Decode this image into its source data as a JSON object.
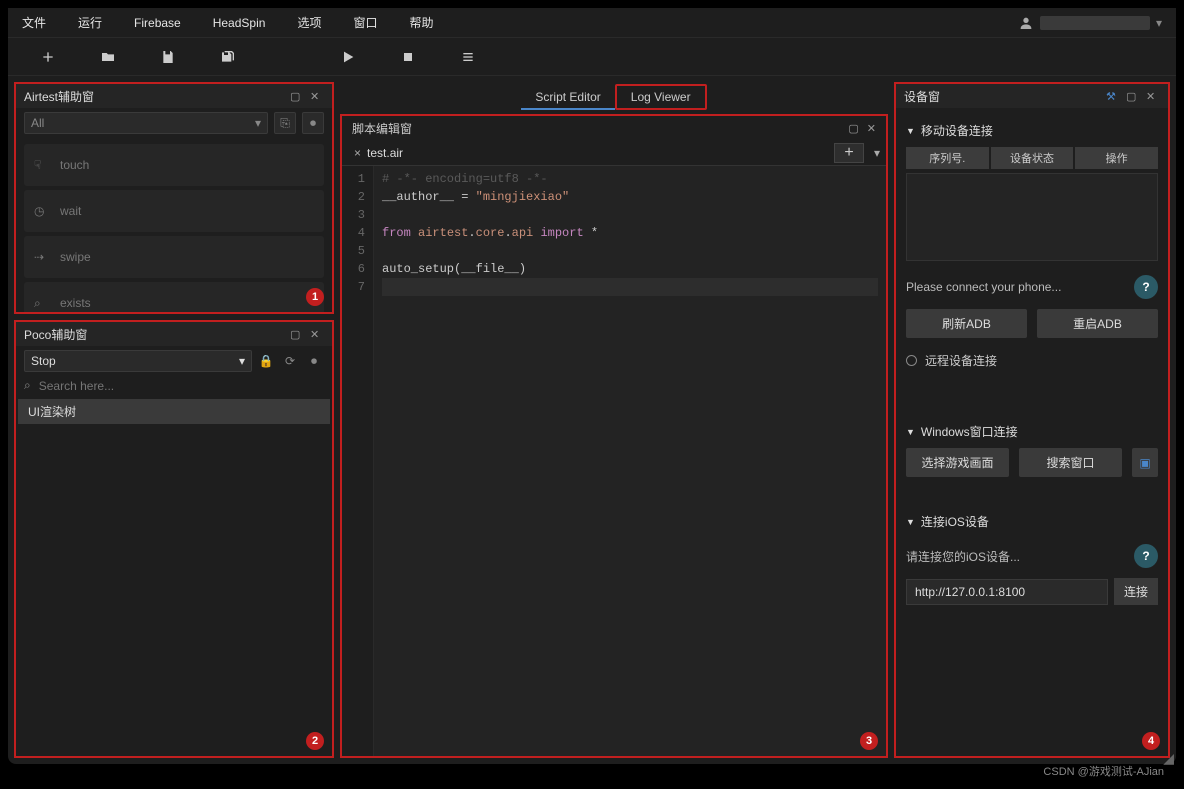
{
  "menu": {
    "items": [
      "文件",
      "运行",
      "Firebase",
      "HeadSpin",
      "选项",
      "窗口",
      "帮助"
    ]
  },
  "airtest": {
    "title": "Airtest辅助窗",
    "dropdown": "All",
    "items": [
      {
        "icon": "touch-icon",
        "label": "touch"
      },
      {
        "icon": "wait-icon",
        "label": "wait"
      },
      {
        "icon": "swipe-icon",
        "label": "swipe"
      },
      {
        "icon": "exists-icon",
        "label": "exists"
      }
    ],
    "badge": "1"
  },
  "poco": {
    "title": "Poco辅助窗",
    "dropdown": "Stop",
    "search_placeholder": "Search here...",
    "tree_item": "UI渲染树",
    "badge": "2"
  },
  "tabs": {
    "script_editor": "Script Editor",
    "log_viewer": "Log Viewer"
  },
  "editor": {
    "title": "脚本编辑窗",
    "file_tab": "test.air",
    "lines": [
      "1",
      "2",
      "3",
      "4",
      "5",
      "6",
      "7"
    ],
    "code": {
      "l1_comment": "# -*- encoding=utf8 -*-",
      "l2_var": "__author__",
      "l2_eq": " = ",
      "l2_str": "\"mingjiexiao\"",
      "l4_from": "from",
      "l4_mod1": " airtest",
      "l4_dot1": ".",
      "l4_mod2": "core",
      "l4_dot2": ".",
      "l4_mod3": "api",
      "l4_import": " import",
      "l4_star": " *",
      "l6": "auto_setup(__file__)"
    },
    "badge": "3"
  },
  "devices": {
    "title": "设备窗",
    "mobile_header": "移动设备连接",
    "table": {
      "col1": "序列号.",
      "col2": "设备状态",
      "col3": "操作"
    },
    "connect_msg": "Please connect your phone...",
    "refresh_adb": "刷新ADB",
    "restart_adb": "重启ADB",
    "remote_header": "远程设备连接",
    "windows_header": "Windows窗口连接",
    "select_game": "选择游戏画面",
    "search_window": "搜索窗口",
    "ios_header": "连接iOS设备",
    "ios_msg": "请连接您的iOS设备...",
    "ios_url": "http://127.0.0.1:8100",
    "connect_btn": "连接",
    "badge": "4"
  },
  "watermark": "CSDN @游戏测试-AJian"
}
